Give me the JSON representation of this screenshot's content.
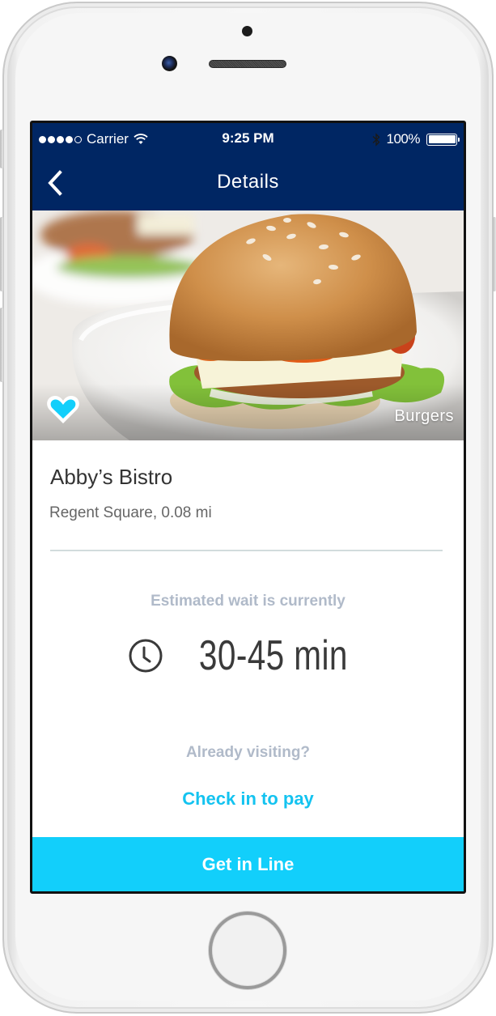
{
  "status_bar": {
    "signal_bars_filled": 4,
    "signal_bars_total": 5,
    "carrier": "Carrier",
    "wifi_icon": "wifi-icon",
    "time": "9:25 PM",
    "bluetooth_icon": "bluetooth-icon",
    "battery_percent": "100%",
    "battery_level": 1.0
  },
  "nav_bar": {
    "back_icon": "chevron-left-icon",
    "title": "Details"
  },
  "hero": {
    "image_description": "Chicken slider burger with cheese, lettuce and sesame bun on a white plate",
    "favorite_icon": "heart-icon",
    "favorited": true,
    "category": "Burgers"
  },
  "restaurant": {
    "name": "Abby’s Bistro",
    "location": "Regent Square, 0.08 mi"
  },
  "wait": {
    "label": "Estimated wait is currently",
    "clock_icon": "clock-icon",
    "value": "30-45 min"
  },
  "visit": {
    "prompt": "Already visiting?",
    "checkin_label": "Check in to pay"
  },
  "primary_action": {
    "label": "Get in Line"
  },
  "colors": {
    "nav_background": "#002663",
    "accent": "#12cffb",
    "link": "#14c3f0",
    "muted_text": "#b0bac9",
    "primary_text": "#333333",
    "divider": "#d2dcdd"
  }
}
